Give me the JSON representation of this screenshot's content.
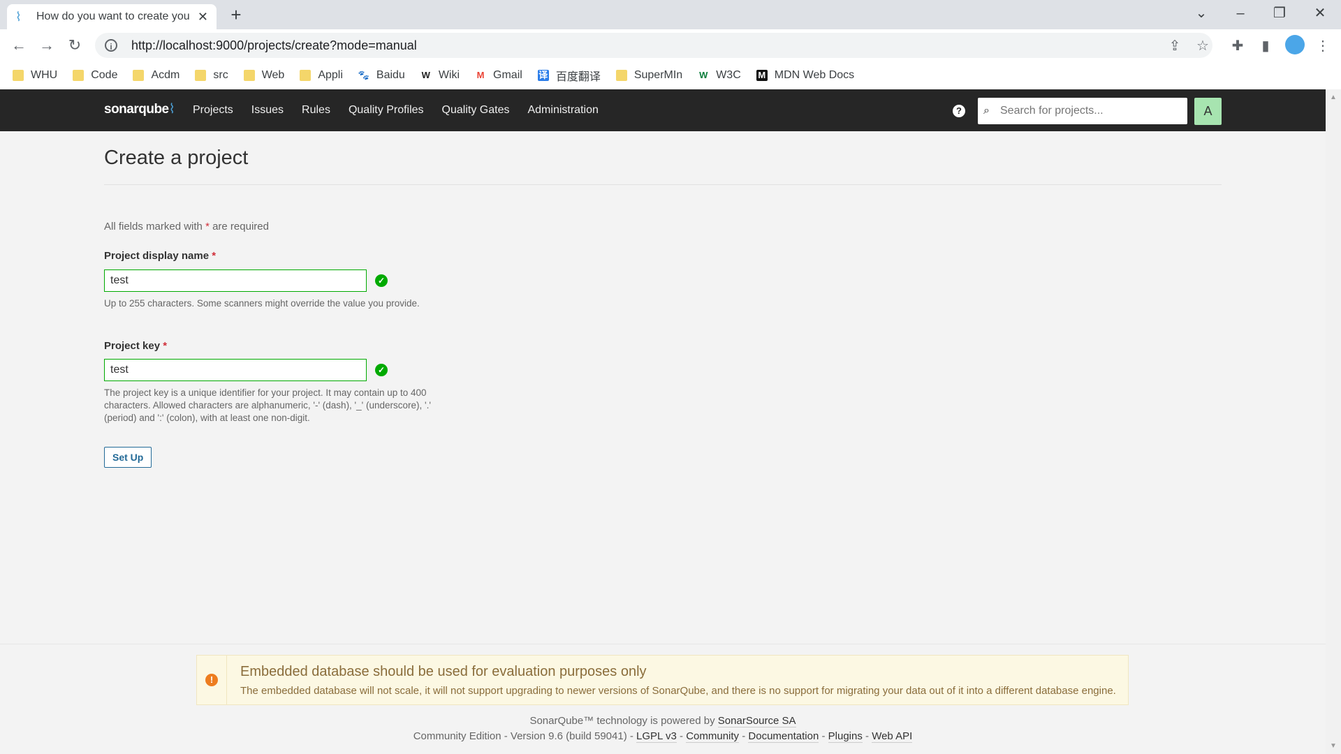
{
  "browser": {
    "tab_title": "How do you want to create your project?",
    "url": "http://localhost:9000/projects/create?mode=manual",
    "bookmarks": [
      {
        "label": "WHU",
        "icon": "folder-icon"
      },
      {
        "label": "Code",
        "icon": "folder-icon"
      },
      {
        "label": "Acdm",
        "icon": "folder-icon"
      },
      {
        "label": "src",
        "icon": "folder-icon"
      },
      {
        "label": "Web",
        "icon": "folder-icon"
      },
      {
        "label": "Appli",
        "icon": "folder-icon"
      },
      {
        "label": "Baidu",
        "icon": "baidu-icon"
      },
      {
        "label": "Wiki",
        "icon": "wikipedia-icon"
      },
      {
        "label": "Gmail",
        "icon": "gmail-icon"
      },
      {
        "label": "百度翻译",
        "icon": "translate-icon"
      },
      {
        "label": "SuperMIn",
        "icon": "folder-icon"
      },
      {
        "label": "W3C",
        "icon": "w3c-icon"
      },
      {
        "label": "MDN Web Docs",
        "icon": "mdn-icon"
      }
    ]
  },
  "nav": {
    "logo": "sonarqube",
    "links": [
      "Projects",
      "Issues",
      "Rules",
      "Quality Profiles",
      "Quality Gates",
      "Administration"
    ],
    "search_placeholder": "Search for projects...",
    "avatar_letter": "A"
  },
  "main": {
    "title": "Create a project",
    "required_note_pre": "All fields marked with",
    "required_star": "*",
    "required_note_post": "are required",
    "display_name": {
      "label": "Project display name",
      "value": "test",
      "help": "Up to 255 characters. Some scanners might override the value you provide."
    },
    "project_key": {
      "label": "Project key",
      "value": "test",
      "help": "The project key is a unique identifier for your project. It may contain up to 400 characters. Allowed characters are alphanumeric, '-' (dash), '_' (underscore), '.' (period) and ':' (colon), with at least one non-digit."
    },
    "setup_button": "Set Up"
  },
  "alert": {
    "title": "Embedded database should be used for evaluation purposes only",
    "body": "The embedded database will not scale, it will not support upgrading to newer versions of SonarQube, and there is no support for migrating your data out of it into a different database engine."
  },
  "footer": {
    "powered_pre": "SonarQube™ technology is powered by",
    "powered_link": "SonarSource SA",
    "edition": "Community Edition - Version 9.6 (build 59041) -",
    "links": [
      "LGPL v3",
      "Community",
      "Documentation",
      "Plugins",
      "Web API"
    ]
  },
  "colors": {
    "nav_bg": "#262626",
    "valid_green": "#00aa00",
    "button_blue": "#236a97",
    "alert_bg": "#fcf8e3",
    "warning_orange": "#ed7d20"
  }
}
